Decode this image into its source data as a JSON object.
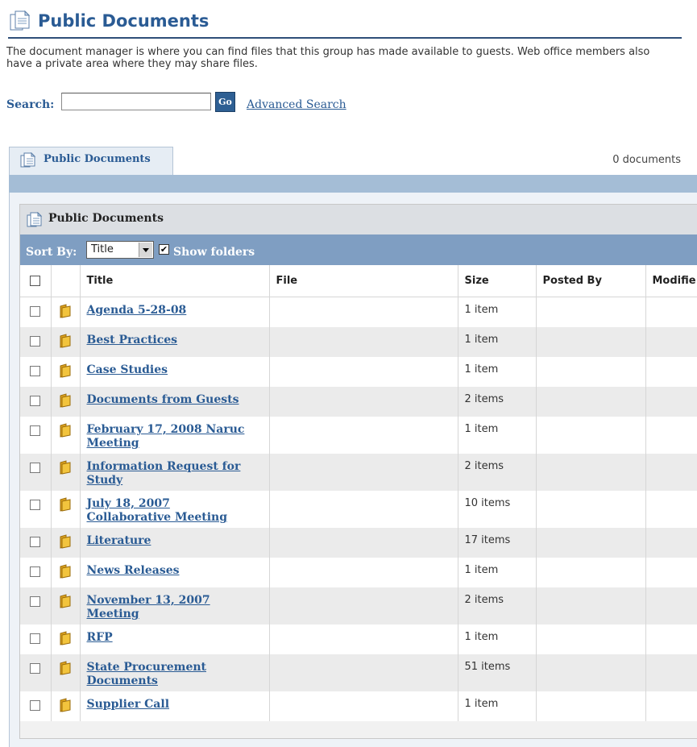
{
  "page": {
    "title": "Public Documents",
    "intro": "The document manager is where you can find files that this group has made available to guests. Web office members also have a private area where they may share files."
  },
  "search": {
    "label": "Search:",
    "value": "",
    "placeholder": "",
    "go_label": "Go",
    "advanced_label": "Advanced Search"
  },
  "tab": {
    "label": "Public Documents"
  },
  "doc_count": "0 documents",
  "panel": {
    "title": "Public Documents",
    "sort_label": "Sort By:",
    "sort_value": "Title",
    "show_folders_label": "Show folders",
    "show_folders_checked": true
  },
  "table": {
    "columns": [
      "Title",
      "File",
      "Size",
      "Posted By",
      "Modifie"
    ],
    "rows": [
      {
        "title": "Agenda 5-28-08",
        "file": "",
        "size": "1 item",
        "posted_by": ""
      },
      {
        "title": "Best Practices",
        "file": "",
        "size": "1 item",
        "posted_by": ""
      },
      {
        "title": "Case Studies",
        "file": "",
        "size": "1 item",
        "posted_by": ""
      },
      {
        "title": "Documents from Guests",
        "file": "",
        "size": "2 items",
        "posted_by": ""
      },
      {
        "title": "February 17, 2008 Naruc Meeting",
        "file": "",
        "size": "1 item",
        "posted_by": ""
      },
      {
        "title": "Information Request for Study",
        "file": "",
        "size": "2 items",
        "posted_by": ""
      },
      {
        "title": "July 18, 2007 Collaborative Meeting",
        "file": "",
        "size": "10 items",
        "posted_by": ""
      },
      {
        "title": "Literature",
        "file": "",
        "size": "17 items",
        "posted_by": ""
      },
      {
        "title": "News Releases",
        "file": "",
        "size": "1 item",
        "posted_by": ""
      },
      {
        "title": "November 13, 2007 Meeting",
        "file": "",
        "size": "2 items",
        "posted_by": ""
      },
      {
        "title": "RFP",
        "file": "",
        "size": "1 item",
        "posted_by": ""
      },
      {
        "title": "State Procurement Documents",
        "file": "",
        "size": "51 items",
        "posted_by": ""
      },
      {
        "title": "Supplier Call",
        "file": "",
        "size": "1 item",
        "posted_by": ""
      }
    ]
  },
  "colors": {
    "accent": "#2a5b94",
    "sort_bar": "#7f9ec2",
    "tab_band": "#a4bdd6",
    "folder": "#f2c43d"
  },
  "icons": {
    "header": "document-icon",
    "tab": "document-icon",
    "panel": "document-icon",
    "row": "folder-icon"
  }
}
